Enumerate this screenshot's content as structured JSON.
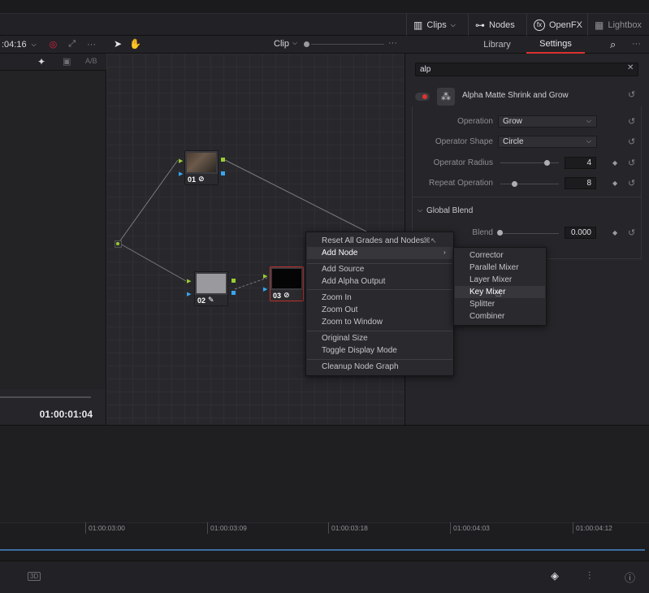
{
  "topbar": {
    "clips": "Clips",
    "nodes": "Nodes",
    "openfx": "OpenFX",
    "lightbox": "Lightbox"
  },
  "viewer": {
    "timecode_top": ":04:16",
    "ab_label": "A/B",
    "timecode": "01:00:01:04"
  },
  "node_graph": {
    "mode": "Clip",
    "nodes": [
      {
        "number": "01"
      },
      {
        "number": "02"
      },
      {
        "number": "03"
      }
    ]
  },
  "panel": {
    "tabs": [
      "Library",
      "Settings"
    ],
    "search_value": "alp",
    "effect_title": "Alpha Matte Shrink and Grow",
    "params": {
      "operation_label": "Operation",
      "operation_value": "Grow",
      "shape_label": "Operator Shape",
      "shape_value": "Circle",
      "radius_label": "Operator Radius",
      "radius_value": "4",
      "repeat_label": "Repeat Operation",
      "repeat_value": "8"
    },
    "global_blend": {
      "title": "Global Blend",
      "blend_label": "Blend",
      "blend_value": "0.000"
    }
  },
  "context_menu": {
    "items": [
      {
        "label": "Reset All Grades and Nodes",
        "shortcut": "⌘↖"
      },
      {
        "label": "Add Node"
      },
      {
        "label": "Add Source"
      },
      {
        "label": "Add Alpha Output"
      },
      {
        "label": "Zoom In"
      },
      {
        "label": "Zoom Out"
      },
      {
        "label": "Zoom to Window"
      },
      {
        "label": "Original Size"
      },
      {
        "label": "Toggle Display Mode"
      },
      {
        "label": "Cleanup Node Graph"
      }
    ],
    "submenu": [
      "Corrector",
      "Parallel Mixer",
      "Layer Mixer",
      "Key Mixer",
      "Splitter",
      "Combiner"
    ]
  },
  "timeline": {
    "ticks": [
      "01:00:03:00",
      "01:00:03:09",
      "01:00:03:18",
      "01:00:04:03",
      "01:00:04:12"
    ]
  },
  "colors": {
    "accent_red": "#d9322e",
    "pin_green": "#9acd32",
    "pin_blue": "#37a6f0",
    "playhead": "#3e6fa3"
  }
}
